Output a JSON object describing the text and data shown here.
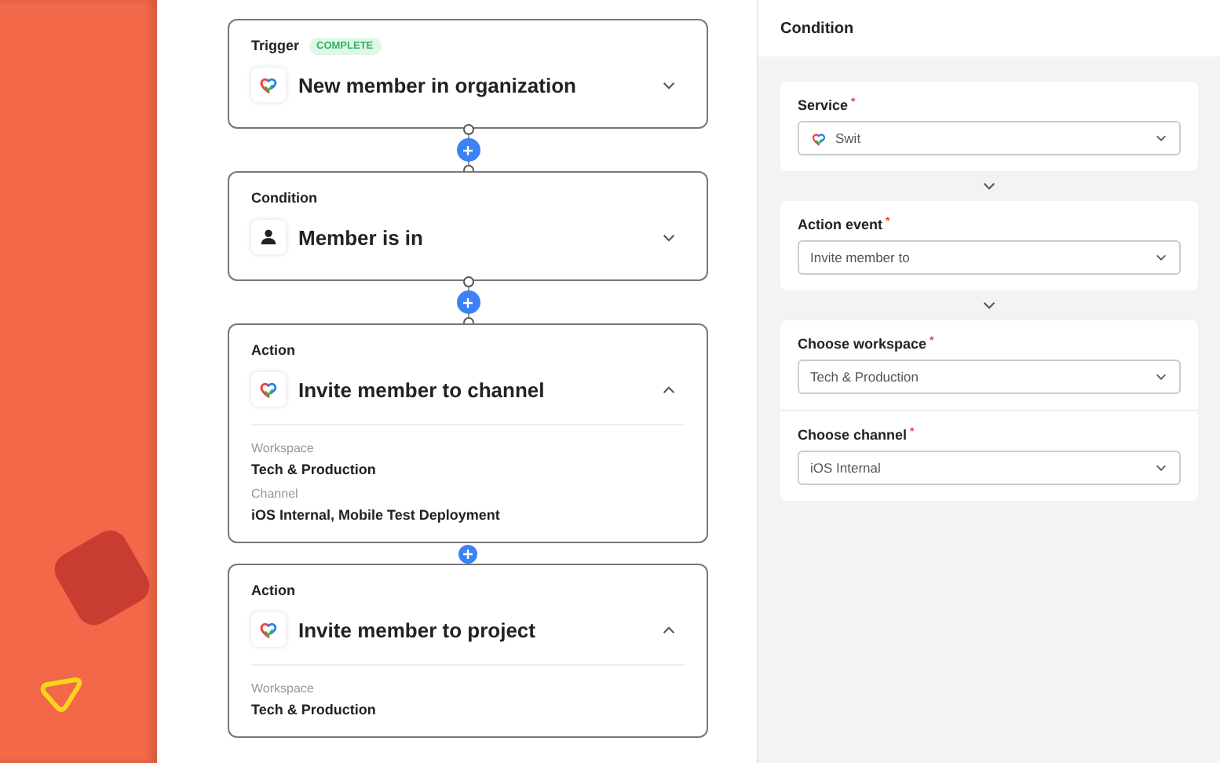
{
  "canvas": {
    "steps": [
      {
        "label": "Trigger",
        "badge": "COMPLETE",
        "kind": "swit",
        "title": "New member in organization",
        "expanded": false
      },
      {
        "label": "Condition",
        "kind": "person",
        "title": "Member is in",
        "expanded": false
      },
      {
        "label": "Action",
        "kind": "swit",
        "title": "Invite member to channel",
        "expanded": true,
        "fields": [
          {
            "label": "Workspace",
            "value": "Tech & Production"
          },
          {
            "label": "Channel",
            "value": "iOS Internal, Mobile Test Deployment"
          }
        ]
      },
      {
        "label": "Action",
        "kind": "swit",
        "title": "Invite member to project",
        "expanded": true,
        "fields": [
          {
            "label": "Workspace",
            "value": "Tech & Production"
          }
        ]
      }
    ],
    "connectors": [
      {
        "kind": "full"
      },
      {
        "kind": "full"
      },
      {
        "kind": "compact"
      }
    ]
  },
  "panel": {
    "title": "Condition",
    "sections": [
      [
        {
          "label": "Service",
          "required_mark": "*",
          "kind": "swit",
          "value": "Swit"
        }
      ],
      [
        {
          "label": "Action event",
          "required_mark": "*",
          "kind": "plain",
          "value": "Invite member to"
        }
      ],
      [
        {
          "label": "Choose workspace",
          "required_mark": "*",
          "kind": "plain",
          "value": "Tech & Production"
        },
        {
          "label": "Choose channel",
          "required_mark": "*",
          "kind": "plain",
          "value": "iOS Internal"
        }
      ]
    ]
  }
}
